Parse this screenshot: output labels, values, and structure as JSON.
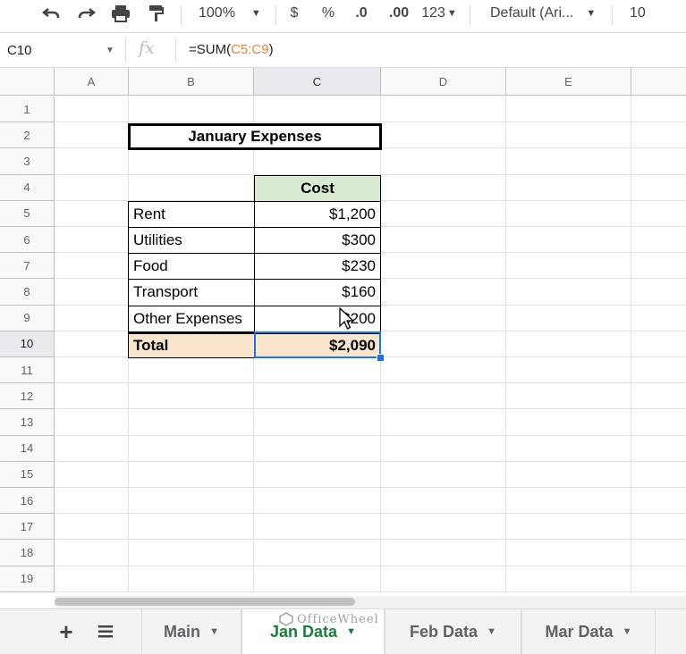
{
  "toolbar": {
    "undo_icon": "undo-icon",
    "redo_icon": "redo-icon",
    "print_icon": "print-icon",
    "paint_format_icon": "paint-format-icon",
    "zoom": "100%",
    "currency": "$",
    "percent": "%",
    "decrease_decimals": ".0",
    "increase_decimals": ".00",
    "more_formats": "123",
    "font": "Default (Ari...",
    "font_size": "10"
  },
  "formula_bar": {
    "name_box": "C10",
    "fx": "fx",
    "formula_prefix": "=SUM(",
    "formula_ref": "C5:C9",
    "formula_suffix": ")"
  },
  "grid": {
    "columns": [
      "A",
      "B",
      "C",
      "D",
      "E"
    ],
    "selected_column": "C",
    "rows": [
      "1",
      "2",
      "3",
      "4",
      "5",
      "6",
      "7",
      "8",
      "9",
      "10",
      "11",
      "12",
      "13",
      "14",
      "15",
      "16",
      "17",
      "18",
      "19"
    ],
    "selected_row": "10",
    "title": "January Expenses",
    "header_label": "Cost",
    "items": [
      {
        "label": "Rent",
        "value": "$1,200"
      },
      {
        "label": "Utilities",
        "value": "$300"
      },
      {
        "label": "Food",
        "value": "$230"
      },
      {
        "label": "Transport",
        "value": "$160"
      },
      {
        "label": "Other Expenses",
        "value": "$200"
      }
    ],
    "total_label": "Total",
    "total_value": "$2,090",
    "colors": {
      "header_fill": "#d9ead3",
      "total_fill": "#fce5cd",
      "selection": "#1a73e8"
    }
  },
  "tabs": {
    "add_icon": "plus-icon",
    "list_icon": "sheets-list-icon",
    "sheets": [
      {
        "label": "Main",
        "active": false
      },
      {
        "label": "Jan Data",
        "active": true
      },
      {
        "label": "Feb Data",
        "active": false
      },
      {
        "label": "Mar Data",
        "active": false
      }
    ]
  },
  "watermark": "OfficeWheel"
}
